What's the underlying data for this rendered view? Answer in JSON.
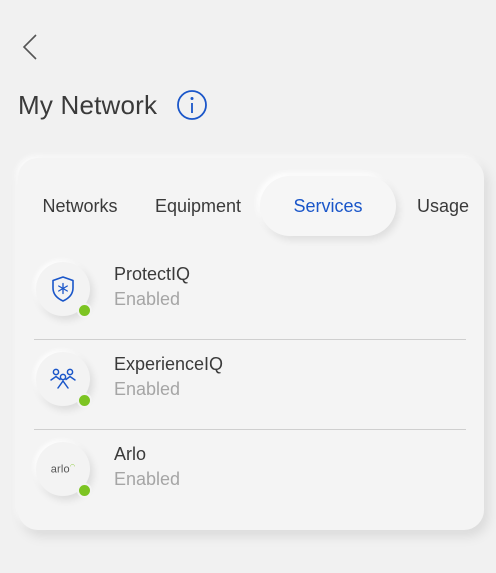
{
  "header": {
    "title": "My Network"
  },
  "tabs": [
    {
      "label": "Networks"
    },
    {
      "label": "Equipment"
    },
    {
      "label": "Services"
    },
    {
      "label": "Usage"
    }
  ],
  "active_tab": "Services",
  "services": [
    {
      "name": "ProtectIQ",
      "status": "Enabled",
      "icon": "shield-snowflake-icon"
    },
    {
      "name": "ExperienceIQ",
      "status": "Enabled",
      "icon": "family-icon"
    },
    {
      "name": "Arlo",
      "status": "Enabled",
      "icon": "arlo-logo",
      "logo_text": "arlo"
    }
  ],
  "colors": {
    "accent": "#1a56c9",
    "status_enabled": "#7cc422",
    "background": "#f1f1f1"
  }
}
